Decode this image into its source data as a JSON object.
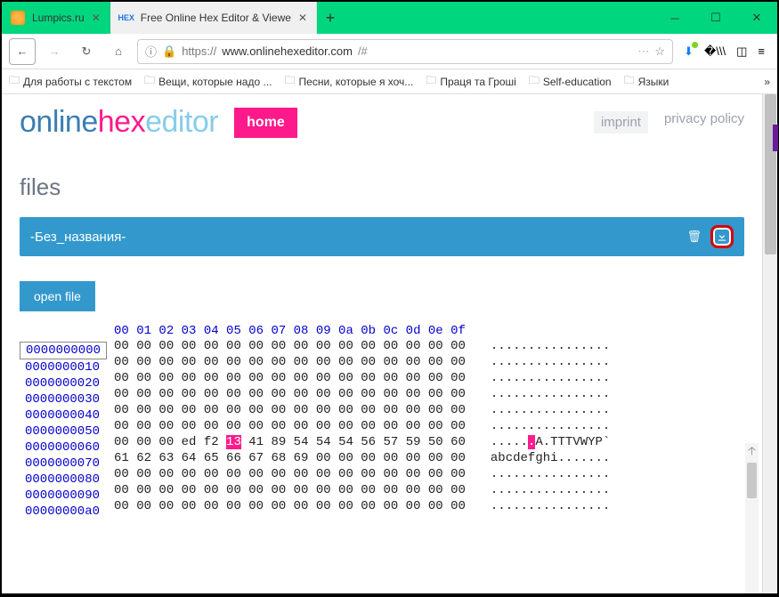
{
  "tabs": [
    {
      "title": "Lumpics.ru",
      "active": false
    },
    {
      "title": "Free Online Hex Editor & Viewe",
      "active": true
    }
  ],
  "nav": {
    "url_proto": "https://",
    "url_host": "www.onlinehexeditor.com",
    "url_path": "/#"
  },
  "bookmarks": [
    "Для работы с текстом",
    "Вещи, которые надо ...",
    "Песни, которые я хоч...",
    "Праця та Гроші",
    "Self-education",
    "Языки"
  ],
  "logo": {
    "p1": "online",
    "p2": "hex",
    "p3": "editor"
  },
  "header": {
    "home": "home",
    "imprint": "imprint",
    "privacy": "privacy policy"
  },
  "section_title": "files",
  "file": {
    "name": "-Без_названия-"
  },
  "buttons": {
    "open_file": "open file"
  },
  "hex": {
    "header": "00 01 02 03 04 05 06 07 08 09 0a 0b 0c 0d 0e 0f",
    "offsets": [
      "0000000000",
      "0000000010",
      "0000000020",
      "0000000030",
      "0000000040",
      "0000000050",
      "0000000060",
      "0000000070",
      "0000000080",
      "0000000090",
      "00000000a0"
    ],
    "rows_hex": [
      [
        "00 00 00 00 00 00 00 00 00 00 00 00 00 00 00 00",
        "",
        ""
      ],
      [
        "00 00 00 00 00 00 00 00 00 00 00 00 00 00 00 00",
        "",
        ""
      ],
      [
        "00 00 00 00 00 00 00 00 00 00 00 00 00 00 00 00",
        "",
        ""
      ],
      [
        "00 00 00 00 00 00 00 00 00 00 00 00 00 00 00 00",
        "",
        ""
      ],
      [
        "00 00 00 00 00 00 00 00 00 00 00 00 00 00 00 00",
        "",
        ""
      ],
      [
        "00 00 00 00 00 00 00 00 00 00 00 00 00 00 00 00",
        "",
        ""
      ],
      [
        "00 00 00 ed f2 ",
        "13",
        " 41 89 54 54 54 56 57 59 50 60"
      ],
      [
        "61 62 63 64 65 66 67 68 69 00 00 00 00 00 00 00",
        "",
        ""
      ],
      [
        "00 00 00 00 00 00 00 00 00 00 00 00 00 00 00 00",
        "",
        ""
      ],
      [
        "00 00 00 00 00 00 00 00 00 00 00 00 00 00 00 00",
        "",
        ""
      ],
      [
        "00 00 00 00 00 00 00 00 00 00 00 00 00 00 00 00",
        "",
        ""
      ]
    ],
    "rows_ascii": [
      [
        "................",
        "",
        ""
      ],
      [
        "................",
        "",
        ""
      ],
      [
        "................",
        "",
        ""
      ],
      [
        "................",
        "",
        ""
      ],
      [
        "................",
        "",
        ""
      ],
      [
        "................",
        "",
        ""
      ],
      [
        ".....",
        ".",
        "A.TTTVWYP`"
      ],
      [
        "abcdefghi.......",
        "",
        ""
      ],
      [
        "................",
        "",
        ""
      ],
      [
        "................",
        "",
        ""
      ],
      [
        "................",
        "",
        ""
      ]
    ]
  }
}
